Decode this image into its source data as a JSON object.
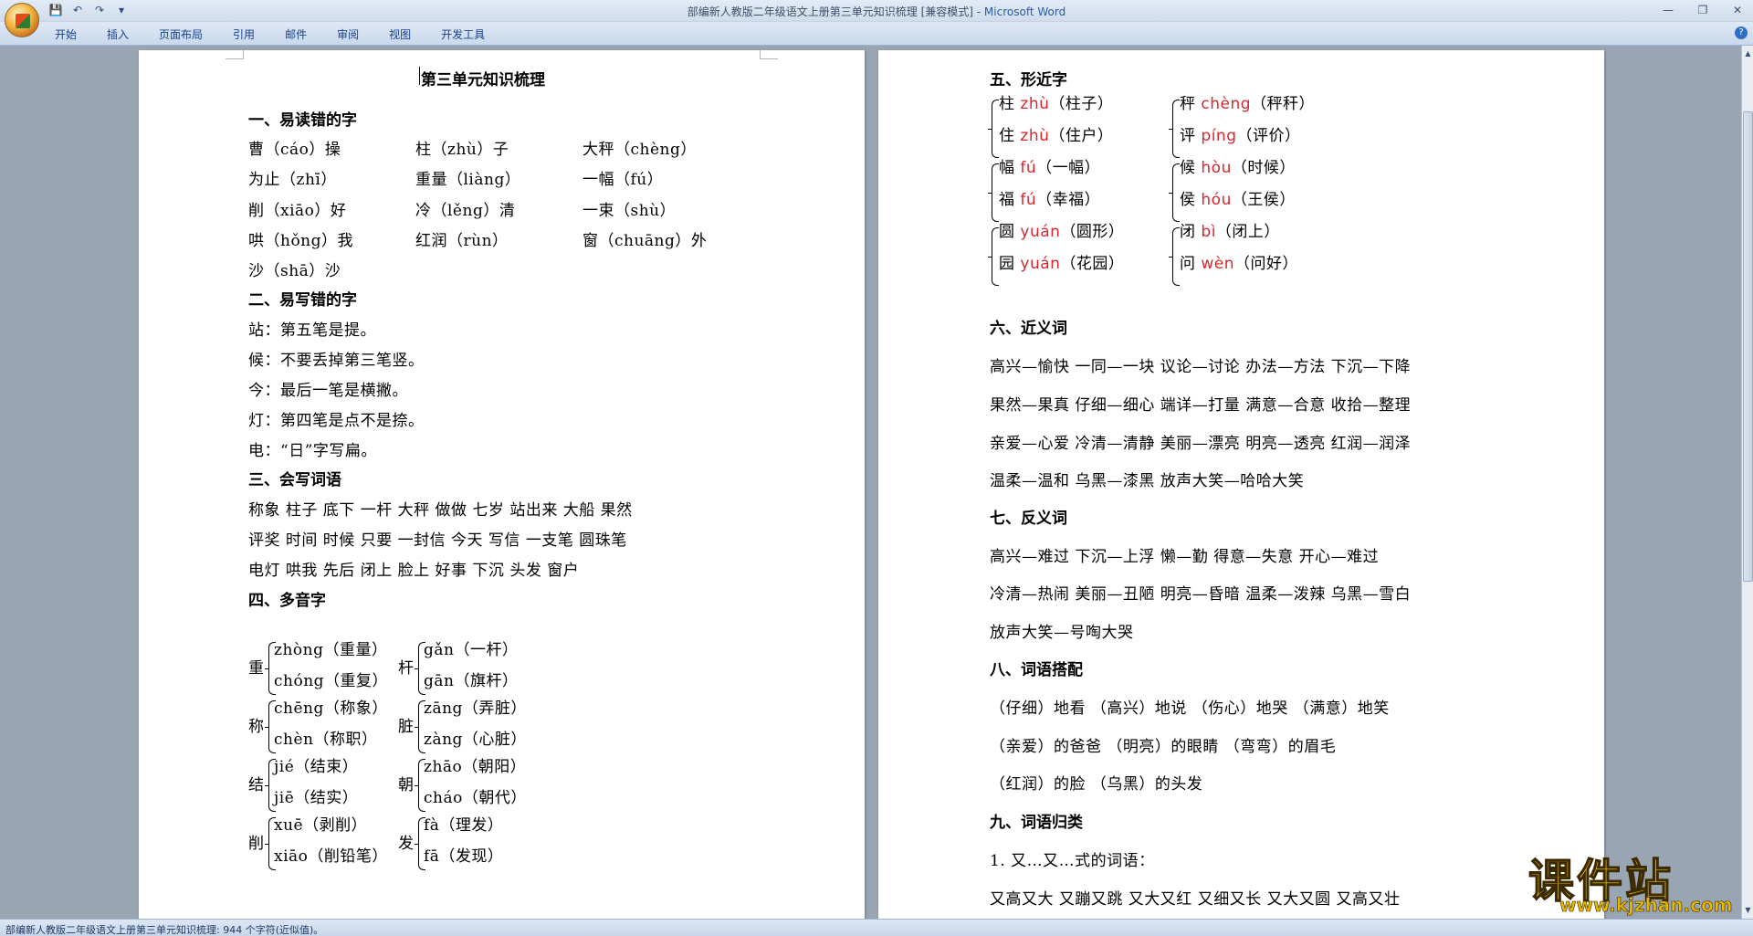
{
  "app": {
    "title": "部编新人教版二年级语文上册第三单元知识梳理 [兼容模式]",
    "product": " - Microsoft Word",
    "tabs": [
      "开始",
      "插入",
      "页面布局",
      "引用",
      "邮件",
      "审阅",
      "视图",
      "开发工具"
    ],
    "status": "部编新人教版二年级语文上册第三单元知识梳理: 944 个字符(近似值)。",
    "help": "?",
    "qat": [
      "💾",
      "↶",
      "↷",
      "▾"
    ],
    "win": [
      "—",
      "❐",
      "✕"
    ]
  },
  "watermark": {
    "cn": "课件站",
    "url": "www.kjzhan.com"
  },
  "colors": {
    "pinyin_red": "#d9262c",
    "ribbon_text": "#15428b"
  },
  "page1": {
    "title": "第三单元知识梳理",
    "s1": "一、易读错的字",
    "s1r": [
      [
        "曹（cáo）操",
        "柱（zhù）子",
        "大秤（chèng）"
      ],
      [
        "为止（zhī）",
        "重量（liàng）",
        "一幅（fú）"
      ],
      [
        "削（xiāo）好",
        "冷（lěng）清",
        "一束（shù）"
      ],
      [
        "哄（hǒng）我",
        "红润（rùn）",
        "窗（chuāng）外"
      ],
      [
        "沙（shā）沙"
      ]
    ],
    "s2": "二、易写错的字",
    "s2l": [
      "站：第五笔是提。",
      "候：不要丢掉第三笔竖。",
      "今：最后一笔是横撇。",
      "灯：第四笔是点不是捺。",
      "电：“日”字写扁。"
    ],
    "s3": "三、会写词语",
    "s3l": [
      "称象 柱子 底下 一杆 大秤 做做 七岁 站出来 大船 果然",
      "评奖 时间 时候 只要 一封信 今天 写信 一支笔 圆珠笔",
      "电灯 哄我 先后 闭上 脸上 好事 下沉 头发 窗户"
    ],
    "s4": "四、多音字",
    "s4g": [
      {
        "c": "重",
        "a": "zhòng（重量）",
        "b": "chóng（重复）"
      },
      {
        "c": "杆",
        "a": "gǎn（一杆）",
        "b": "gān（旗杆）"
      },
      {
        "c": "称",
        "a": "chēng（称象）",
        "b": "chèn（称职）"
      },
      {
        "c": "脏",
        "a": "zāng（弄脏）",
        "b": "zàng（心脏）"
      },
      {
        "c": "结",
        "a": "jié（结束）",
        "b": "jiē（结实）"
      },
      {
        "c": "朝",
        "a": "zhāo（朝阳）",
        "b": "cháo（朝代）"
      },
      {
        "c": "削",
        "a": "xuē（剥削）",
        "b": "xiāo（削铅笔）"
      },
      {
        "c": "发",
        "a": "fà（理发）",
        "b": "fā（发现）"
      }
    ]
  },
  "page2": {
    "s5": "五、形近字",
    "s5g": [
      [
        {
          "c": "柱",
          "p": "zhù",
          "w": "（柱子）"
        },
        {
          "c": "住",
          "p": "zhù",
          "w": "（住户）"
        }
      ],
      [
        {
          "c": "秤",
          "p": "chèng",
          "w": "（秤秆）"
        },
        {
          "c": "评",
          "p": "píng",
          "w": "（评价）"
        }
      ],
      [
        {
          "c": "幅",
          "p": "fú",
          "w": "（一幅）"
        },
        {
          "c": "福",
          "p": "fú",
          "w": "（幸福）"
        }
      ],
      [
        {
          "c": "候",
          "p": "hòu",
          "w": "（时候）"
        },
        {
          "c": "侯",
          "p": "hóu",
          "w": "（王侯）"
        }
      ],
      [
        {
          "c": "圆",
          "p": "yuán",
          "w": "（圆形）"
        },
        {
          "c": "园",
          "p": "yuán",
          "w": "（花园）"
        }
      ],
      [
        {
          "c": "闭",
          "p": "bì",
          "w": "（闭上）"
        },
        {
          "c": "问",
          "p": "wèn",
          "w": "（问好）"
        }
      ]
    ],
    "s6": "六、近义词",
    "s6l": [
      "高兴—愉快 一同—一块 议论—讨论 办法—方法 下沉—下降",
      "果然—果真 仔细—细心 端详—打量 满意—合意 收拾—整理",
      "亲爱—心爱 冷清—清静 美丽—漂亮 明亮—透亮 红润—润泽",
      "温柔—温和 乌黑—漆黑 放声大笑—哈哈大笑"
    ],
    "s7": "七、反义词",
    "s7l": [
      "高兴—难过 下沉—上浮 懒—勤 得意—失意 开心—难过",
      "冷清—热闹 美丽—丑陋 明亮—昏暗 温柔—泼辣 乌黑—雪白",
      "放声大笑—号啕大哭"
    ],
    "s8": "八、词语搭配",
    "s8l": [
      "（仔细）地看 （高兴）地说  （伤心）地哭 （满意）地笑",
      "（亲爱）的爸爸 （明亮）的眼睛 （弯弯）的眉毛",
      "（红润）的脸  （乌黑）的头发"
    ],
    "s9": "九、词语归类",
    "s9a": "1. 又…又…式的词语：",
    "s9b": "又高又大  又蹦又跳 又大又红 又细又长 又大又圆 又高又壮"
  }
}
